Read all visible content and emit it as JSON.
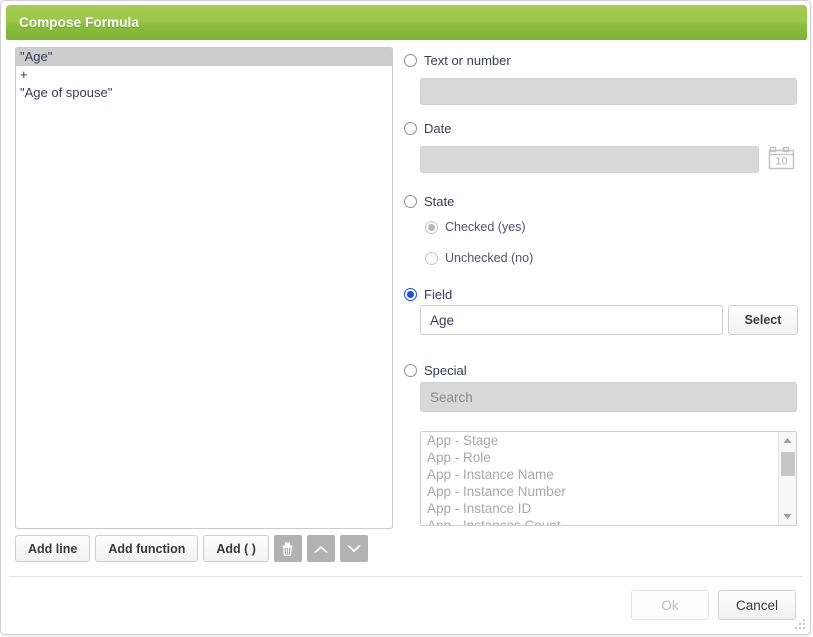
{
  "window": {
    "title": "Compose Formula"
  },
  "formula": {
    "lines": [
      {
        "text": "\"Age\"",
        "selected": true
      },
      {
        "text": "+",
        "selected": false
      },
      {
        "text": "\"Age of spouse\"",
        "selected": false
      }
    ]
  },
  "toolbar": {
    "add_line_label": "Add line",
    "add_function_label": "Add function",
    "add_parens_label": "Add ( )",
    "delete_icon": "trash-icon",
    "move_up_icon": "chevron-up-icon",
    "move_down_icon": "chevron-down-icon"
  },
  "options": {
    "text_or_number": {
      "label": "Text or number",
      "selected": false,
      "value": "",
      "placeholder": "",
      "disabled": true
    },
    "date": {
      "label": "Date",
      "selected": false,
      "value": "",
      "placeholder": "",
      "disabled": true,
      "calendar_icon": "calendar-icon",
      "calendar_day": "10"
    },
    "state": {
      "label": "State",
      "selected": false,
      "choices": [
        {
          "label": "Checked (yes)",
          "selected": true,
          "disabled": true
        },
        {
          "label": "Unchecked (no)",
          "selected": false,
          "disabled": true
        }
      ]
    },
    "field": {
      "label": "Field",
      "selected": true,
      "value": "Age",
      "placeholder": "",
      "select_button_label": "Select"
    },
    "special": {
      "label": "Special",
      "selected": false,
      "search_value": "",
      "search_placeholder": "Search",
      "search_disabled": true,
      "items": [
        "App - Stage",
        "App - Role",
        "App - Instance Name",
        "App - Instance Number",
        "App - Instance ID",
        "App - Instances Count"
      ]
    }
  },
  "footer": {
    "ok_label": "Ok",
    "ok_disabled": true,
    "cancel_label": "Cancel"
  },
  "colors": {
    "header_green_top": "#a4ca53",
    "header_green_bottom": "#7fb335",
    "radio_accent": "#1a4fd6",
    "icon_button_bg": "#b2b2b2",
    "selected_line_bg": "#cccccc"
  }
}
